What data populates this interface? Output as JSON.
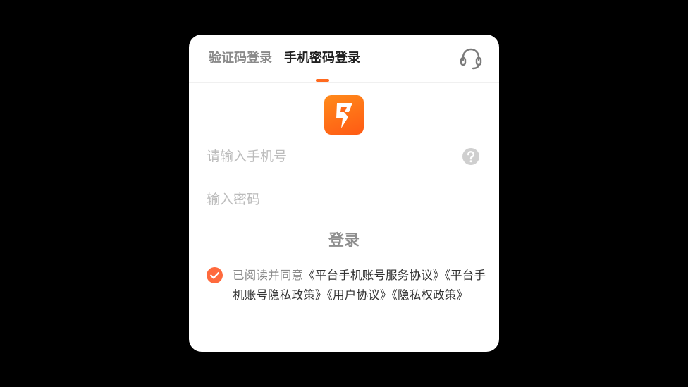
{
  "tabs": [
    {
      "label": "验证码登录",
      "active": false
    },
    {
      "label": "手机密码登录",
      "active": true
    }
  ],
  "icons": {
    "support": "headset-icon",
    "help": "question-circle-icon",
    "check": "check-circle-icon",
    "logo": "lightning-logo-icon"
  },
  "form": {
    "phone_placeholder": "请输入手机号",
    "password_placeholder": "输入密码",
    "login_label": "登录"
  },
  "agreement": {
    "prefix": "已阅读并同意",
    "links": [
      "《平台手机账号服务协议》",
      "《平台手机账号隐私政策》",
      "《用户协议》",
      "《隐私权政策》"
    ]
  },
  "colors": {
    "accent": "#ff6a1f",
    "check": "#ff6a3d",
    "background": "#000000",
    "dialog": "#ffffff"
  }
}
